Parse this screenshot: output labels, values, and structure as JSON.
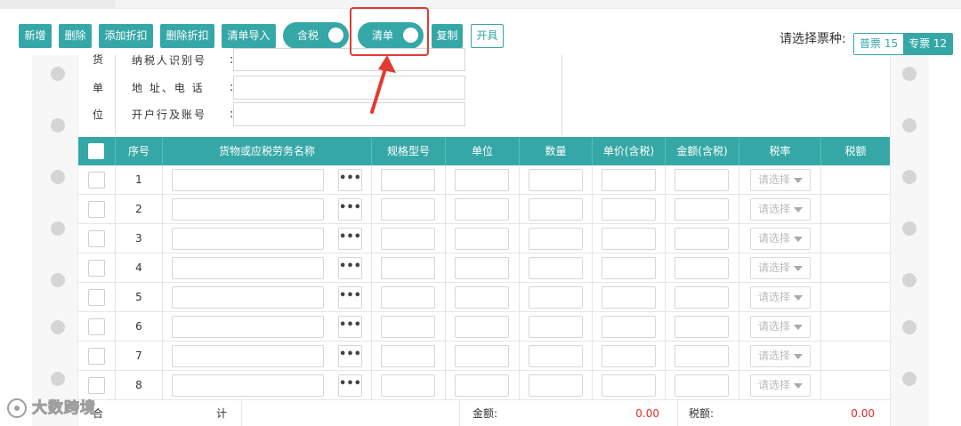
{
  "toolbar": {
    "buttons": [
      "新增",
      "删除",
      "添加折扣",
      "删除折扣",
      "清单导入"
    ],
    "toggle_tax": "含税",
    "toggle_list": "清单",
    "copy": "复制",
    "issue": "开具",
    "ticket_label": "请选择票种:",
    "ticket_normal": "普票 15",
    "ticket_special": "专票 12"
  },
  "seller": {
    "side_chars": [
      "货",
      "单",
      "位"
    ],
    "fields": [
      "纳税人识别号",
      "地 址、电 话",
      "开户行及账号"
    ],
    "colon": ":"
  },
  "table": {
    "headers": [
      "序号",
      "货物或应税劳务名称",
      "规格型号",
      "单位",
      "数量",
      "单价(含税)",
      "金额(含税)",
      "税率",
      "税额"
    ],
    "rows": [
      "1",
      "2",
      "3",
      "4",
      "5",
      "6",
      "7",
      "8"
    ],
    "ellipsis": "•••",
    "rate_placeholder": "请选择"
  },
  "totals": {
    "label_a": "合",
    "label_b": "计",
    "amount_label": "金额:",
    "amount_value": "0.00",
    "tax_label": "税额:",
    "tax_value": "0.00"
  },
  "watermark": "大数跨境",
  "colors": {
    "accent": "#36a7a7",
    "highlight": "#e23b32",
    "total_value": "#e12b2b"
  }
}
